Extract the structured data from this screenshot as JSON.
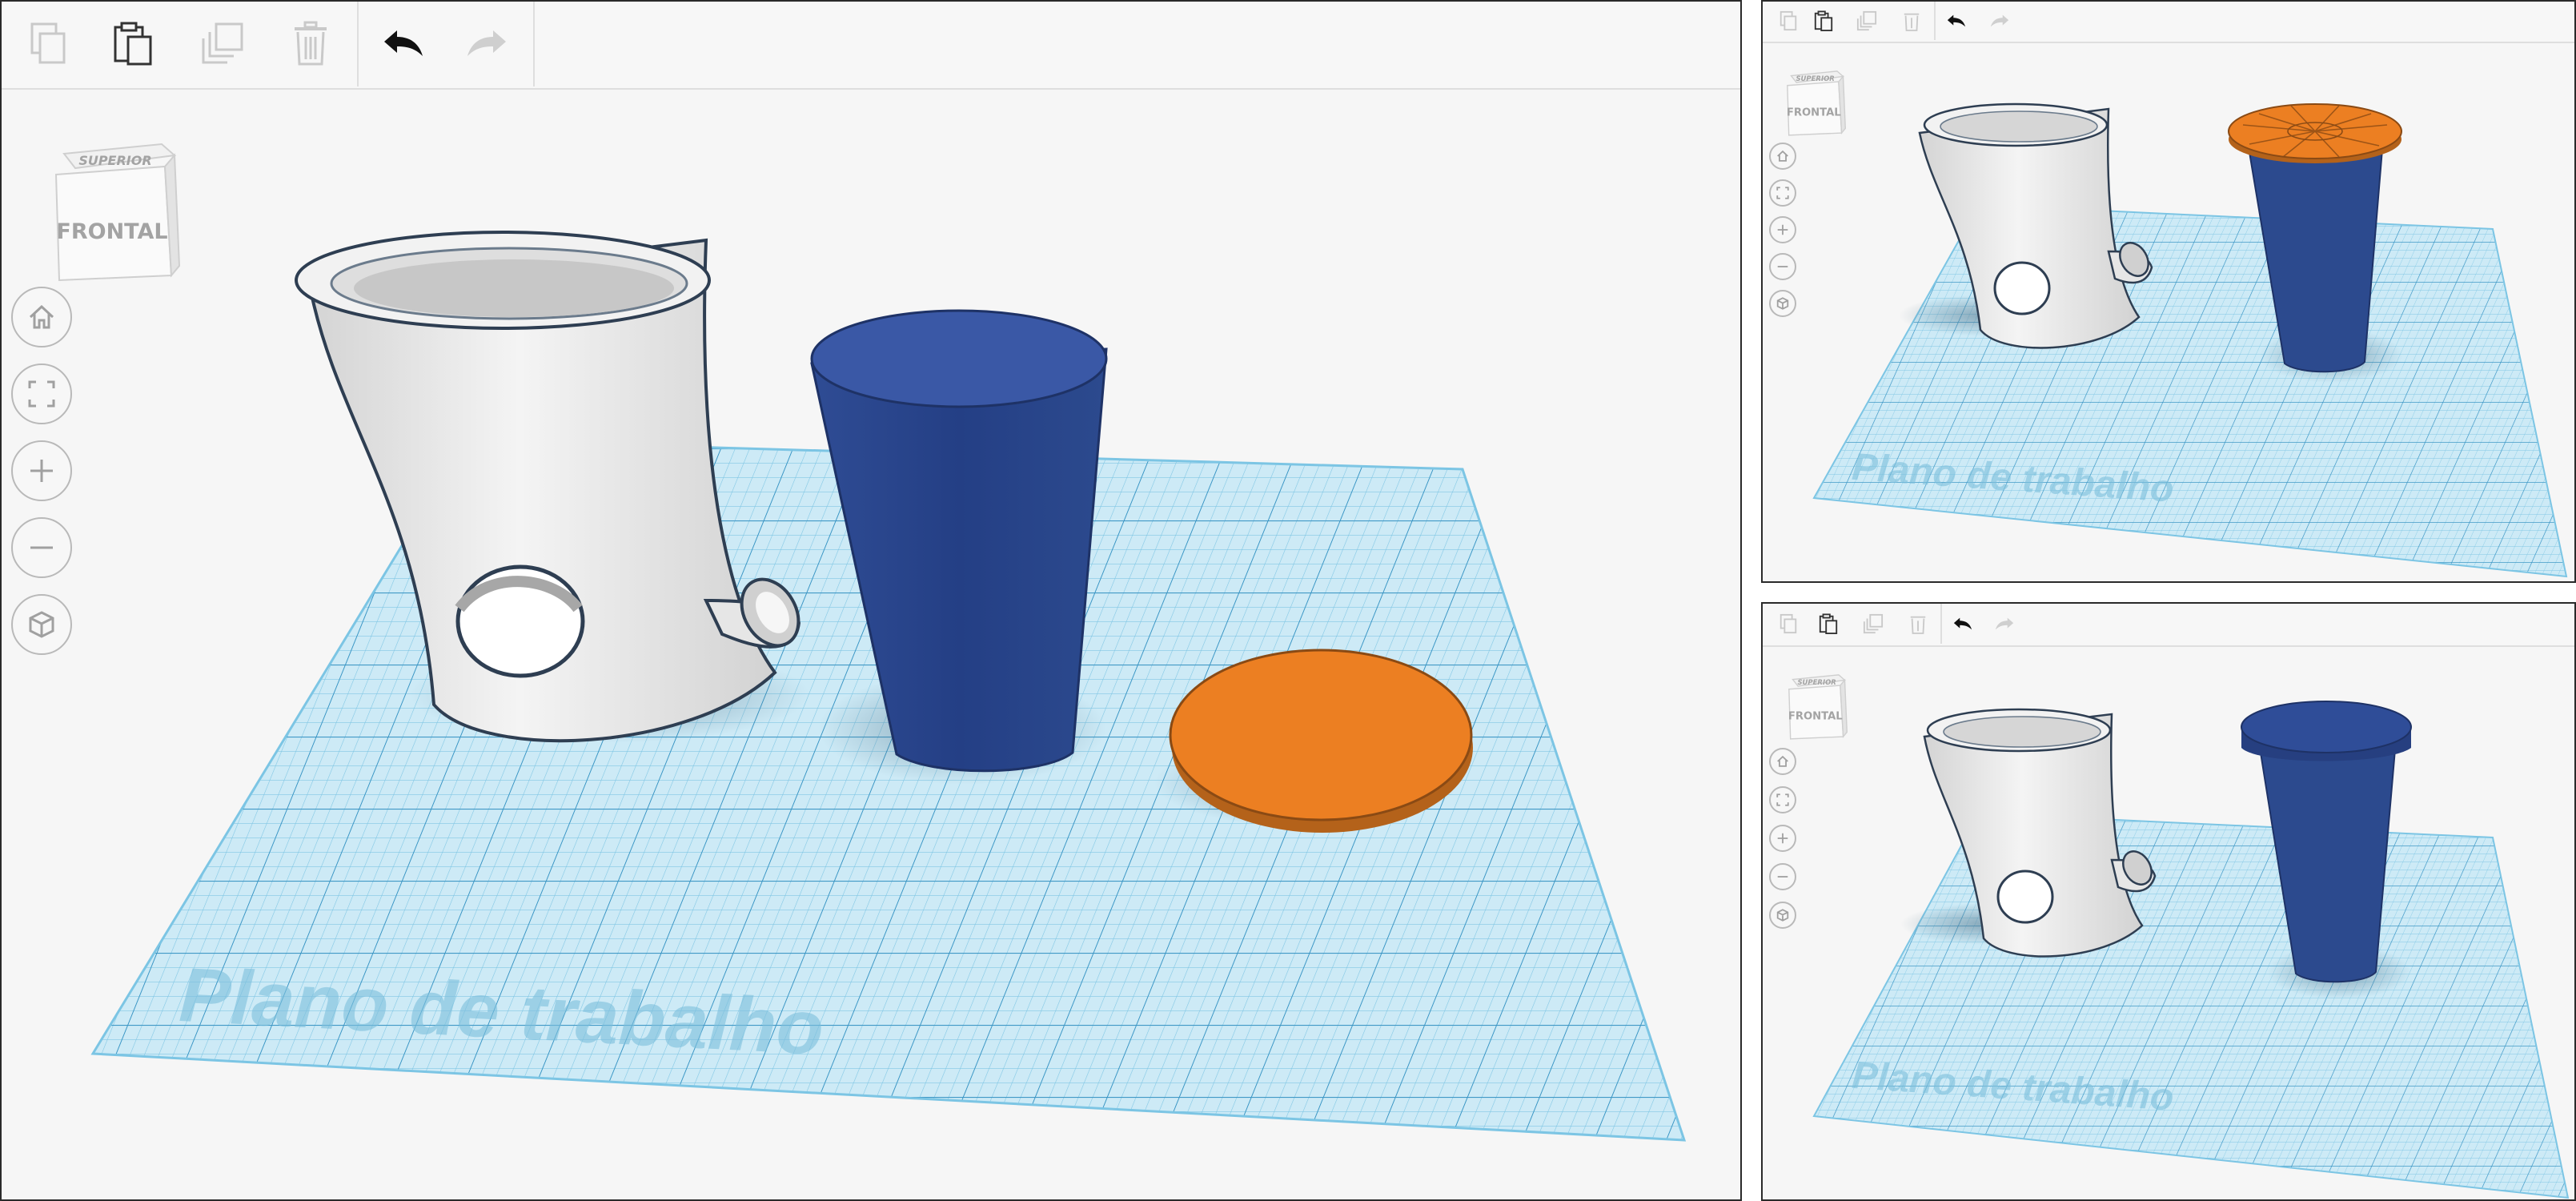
{
  "toolbar": {
    "copy": "copy-icon",
    "paste": "paste-icon",
    "duplicate": "duplicate-icon",
    "delete": "delete-icon",
    "undo": "undo-icon",
    "redo": "redo-icon"
  },
  "viewcube": {
    "top_label": "SUPERIOR",
    "front_label": "FRONTAL"
  },
  "nav": [
    "home-icon",
    "fit-view-icon",
    "zoom-in-icon",
    "zoom-out-icon",
    "perspective-icon"
  ],
  "workplane": {
    "label": "Plano de trabalho",
    "color": "#9ed7ee"
  },
  "colors": {
    "vase": "#e8e8e8",
    "cup": "#2c4a9a",
    "disc": "#ec7f22"
  },
  "panels": [
    {
      "id": "main",
      "state": "orange disc beside blue cup"
    },
    {
      "id": "top-right",
      "state": "orange disc on top of blue cup"
    },
    {
      "id": "bottom-right",
      "state": "blue lid on blue cup"
    }
  ]
}
